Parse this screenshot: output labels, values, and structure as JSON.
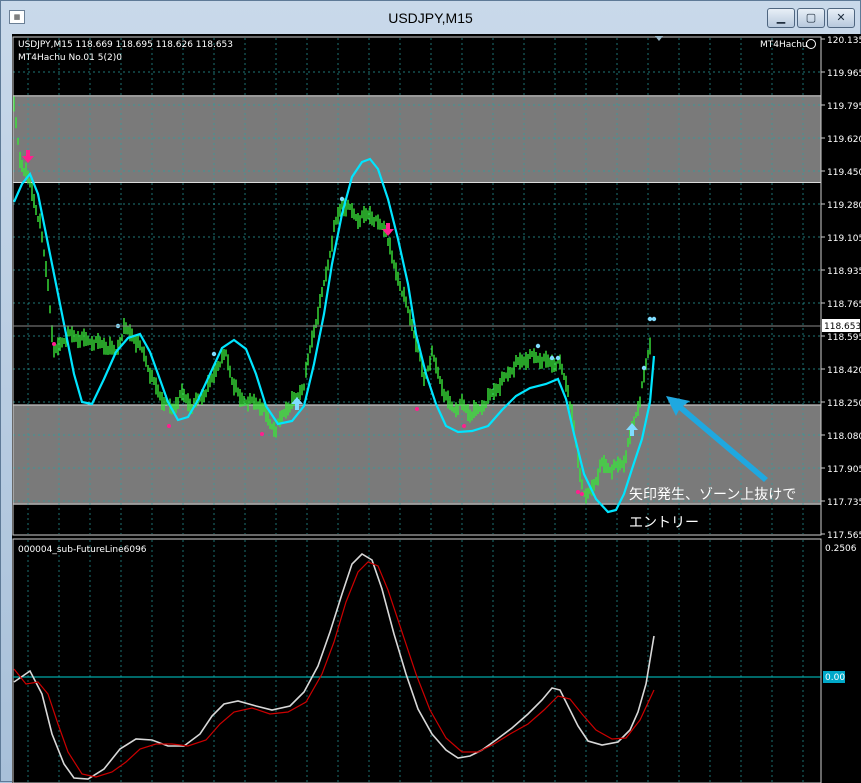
{
  "window": {
    "title": "USDJPY,M15",
    "min_label": "▁",
    "max_label": "▢",
    "close_label": "✕",
    "icon": "chart-window-icon"
  },
  "main_chart": {
    "header": "USDJPY,M15  118.669 118.695 118.626 118.653",
    "indicator_label": "MT4Hachu  No.01  5(2)0",
    "ea_label": "MT4Hachu",
    "ea_icon": "smiley-icon",
    "current_price": "118.653",
    "price_labels": [
      "120.135",
      "119.965",
      "119.795",
      "119.620",
      "119.450",
      "119.280",
      "119.105",
      "118.935",
      "118.765",
      "118.595",
      "118.420",
      "118.250",
      "118.080",
      "117.905",
      "117.735",
      "117.565"
    ],
    "annotation_line1": "矢印発生、ゾーン上抜けで",
    "annotation_line2": "エントリー",
    "zones": [
      {
        "top": 119.84,
        "bottom": 119.39,
        "color": "#7a7a7a"
      },
      {
        "top": 118.235,
        "bottom": 117.72,
        "color": "#7a7a7a"
      }
    ]
  },
  "sub_chart": {
    "label": "000004_sub-FutureLine6096",
    "top_value": "0.2506",
    "zero_value": "0.00"
  },
  "colors": {
    "candle": "#39e639",
    "ma": "#00e5ff",
    "sell_arrow": "#ff1f8e",
    "buy_arrow": "#7fdcff",
    "grid": "#2aa0a0",
    "sub_white": "#d8d8d8",
    "sub_red": "#cc0000",
    "callout": "#1fa8e0"
  }
}
